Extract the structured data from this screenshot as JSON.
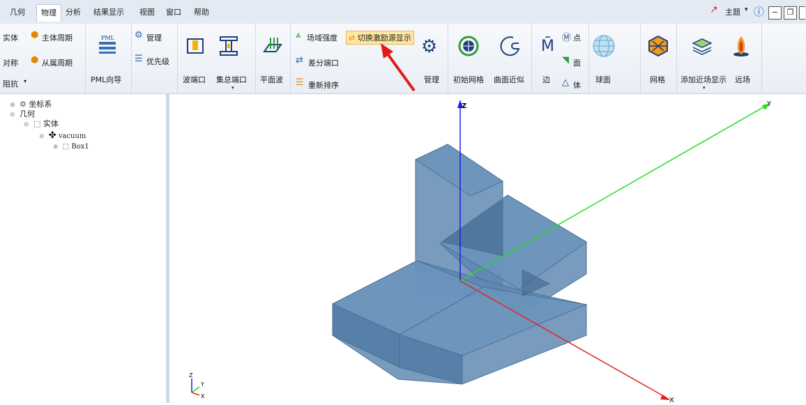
{
  "menu": {
    "items": [
      "几何",
      "物理",
      "分析",
      "结果显示",
      "视图",
      "窗口",
      "帮助"
    ],
    "active": "物理",
    "theme_label": "主题"
  },
  "ribbon": {
    "left_partial": {
      "row1": "实体",
      "row2": "对称",
      "row3": "阻抗",
      "master_period": "主体周期",
      "slave_period": "从属周期"
    },
    "pml": {
      "icon_text": "PML",
      "label": "PML向导"
    },
    "manage_group": {
      "manage": "管理",
      "priority": "优先级"
    },
    "ports": {
      "wave_port": "波端口",
      "lumped_port": "集总端口",
      "plane_wave": "平面波"
    },
    "excitation": {
      "field_strength": "场域强度",
      "toggle_display": "切换激励源显示",
      "diff_port": "差分端口",
      "reorder": "重新排序",
      "manage": "管理"
    },
    "mesh": {
      "initial_mesh": "初始网格",
      "surface_approx": "曲面近似",
      "edge": "边",
      "point": "点",
      "face": "面",
      "body": "体",
      "sphere": "球面",
      "mesh": "网格"
    },
    "far_field": {
      "add_near_field": "添加近场显示",
      "far_field": "远场"
    }
  },
  "tree": {
    "coord": "坐标系",
    "geometry": "几何",
    "solid": "实体",
    "vacuum": "vacuum",
    "box": "Box1"
  },
  "viewport": {
    "axis_z": "Z",
    "axis_y": "Y",
    "axis_x": "X",
    "mini_z": "Z",
    "mini_y": "Y",
    "mini_x": "X",
    "solid_color": "#5b86b0",
    "arrow_color": "#e21b1b"
  }
}
